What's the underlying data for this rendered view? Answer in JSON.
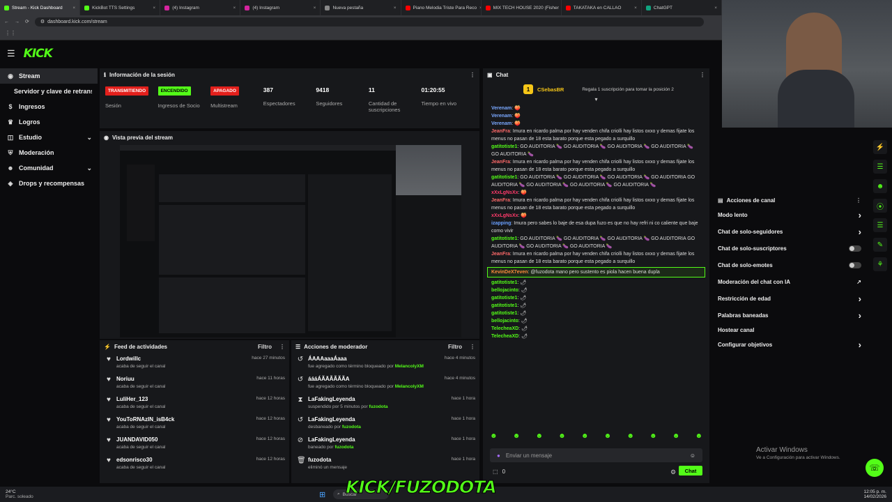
{
  "browser": {
    "tabs": [
      {
        "label": "Stream - Kick Dashboard",
        "color": "#53fc18",
        "active": true
      },
      {
        "label": "KickBot TTS Settings",
        "color": "#53fc18"
      },
      {
        "label": "(4) Instagram",
        "color": "#d6249f"
      },
      {
        "label": "(4) Instagram",
        "color": "#d6249f"
      },
      {
        "label": "Nueva pestaña",
        "color": "#888888"
      },
      {
        "label": "Piano Melodia Triste Para Reco",
        "color": "#ff0000"
      },
      {
        "label": "MIX TECH HOUSE 2020 (Fisher",
        "color": "#ff0000"
      },
      {
        "label": "TAKATAKA en CALLAO",
        "color": "#ff0000"
      },
      {
        "label": "ChatGPT",
        "color": "#10a37f"
      }
    ],
    "url": "dashboard.kick.com/stream"
  },
  "app": {
    "logo": "KICK"
  },
  "sidebar": {
    "items": [
      {
        "label": "Stream",
        "icon": "broadcast-icon",
        "active": true
      },
      {
        "label": "Servidor y clave de retransmisión",
        "icon": ""
      },
      {
        "label": "Ingresos",
        "icon": "money-icon"
      },
      {
        "label": "Logros",
        "icon": "trophy-icon"
      },
      {
        "label": "Estudio",
        "icon": "layers-icon",
        "chevron": true
      },
      {
        "label": "Moderación",
        "icon": "shield-icon"
      },
      {
        "label": "Comunidad",
        "icon": "people-icon",
        "chevron": true
      },
      {
        "label": "Drops y recompensas",
        "icon": "gift-icon"
      }
    ]
  },
  "session": {
    "title": "Información de la sesión",
    "stats": [
      {
        "badge": "TRANSMITIENDO",
        "badge_bg": "#e3201c",
        "badge_fg": "#ffffff",
        "label": "Sesión"
      },
      {
        "badge": "ENCENDIDO",
        "badge_bg": "#53fc18",
        "badge_fg": "#000000",
        "label": "Ingresos de Socio"
      },
      {
        "badge": "APAGADO",
        "badge_bg": "#e3201c",
        "badge_fg": "#ffffff",
        "label": "Multistream"
      },
      {
        "value": "387",
        "label": "Espectadores"
      },
      {
        "value": "9418",
        "label": "Seguidores"
      },
      {
        "value": "11",
        "label": "Cantidad de suscripciones"
      },
      {
        "value": "01:20:55",
        "label": "Tiempo en vivo"
      }
    ]
  },
  "preview": {
    "title": "Vista previa del stream"
  },
  "activity": {
    "title": "Feed de actividades",
    "filter": "Filtro",
    "rows": [
      {
        "name": "Lordwillc",
        "detail": "acaba de seguir el canal",
        "time": "hace 27 minutos"
      },
      {
        "name": "Noriuu",
        "detail": "acaba de seguir el canal",
        "time": "hace 11 horas"
      },
      {
        "name": "LuliHer_123",
        "detail": "acaba de seguir el canal",
        "time": "hace 12 horas"
      },
      {
        "name": "YouToRNAzIN_isB4ck",
        "detail": "acaba de seguir el canal",
        "time": "hace 12 horas"
      },
      {
        "name": "JUANDAVID050",
        "detail": "acaba de seguir el canal",
        "time": "hace 12 horas"
      },
      {
        "name": "edsonrisco30",
        "detail": "acaba de seguir el canal",
        "time": "hace 12 horas"
      }
    ]
  },
  "modactions": {
    "title": "Acciones de moderador",
    "filter": "Filtro",
    "rows": [
      {
        "icon": "↺",
        "name": "ÁAAAaaaÁaaa",
        "detail": "fue agregado como término bloqueado por",
        "who": "MelancolyXM",
        "time": "hace 4 minutos"
      },
      {
        "icon": "↺",
        "name": "áááÁÃÄÃÃÃÃA",
        "detail": "fue agregado como término bloqueado por",
        "who": "MelancolyXM",
        "time": "hace 4 minutos"
      },
      {
        "icon": "⧗",
        "name": "LaFakingLeyenda",
        "detail": "suspendido por 5 minutos por",
        "who": "fuzodota",
        "time": "hace 1 hora"
      },
      {
        "icon": "↺",
        "name": "LaFakingLeyenda",
        "detail": "desbaneado por",
        "who": "fuzodota",
        "time": "hace 1 hora"
      },
      {
        "icon": "⊘",
        "name": "LaFakingLeyenda",
        "detail": "baneado por",
        "who": "fuzodota",
        "time": "hace 1 hora"
      },
      {
        "icon": "🗑",
        "name": "fuzodota",
        "detail": "eliminó un mensaje",
        "who": "",
        "time": "hace 1 hora"
      }
    ]
  },
  "chat": {
    "title": "Chat",
    "pinned_user": "CSebasBR",
    "pinned_text": "Regala 1 suscripción para tomar la posición 2",
    "messages": [
      {
        "user": "Verenam",
        "color": "#7aa8ff",
        "text": "🍑"
      },
      {
        "user": "Verenam",
        "color": "#7aa8ff",
        "text": "🍑"
      },
      {
        "user": "Verenam",
        "color": "#7aa8ff",
        "text": "🍑"
      },
      {
        "user": "JeanFra",
        "color": "#ff6a6a",
        "text": "Imura en ricardo palma por hay venden chifa criolli hay listos oxxo y demas fijate los menus no pasan de 18 esta barato porque esta pegado a surquillo"
      },
      {
        "user": "gatitotiste1",
        "color": "#53fc18",
        "text": "GO AUDITORIA 🍆 GO AUDITORIA 🍆 GO AUDITORIA 🍆 GO AUDITORIA 🍆 GO AUDITORIA 🍆"
      },
      {
        "user": "JeanFra",
        "color": "#ff6a6a",
        "text": "Imura en ricardo palma por hay venden chifa criolli hay listos oxxo y demas fijate los menus no pasan de 18 esta barato porque esta pegado a surquillo"
      },
      {
        "user": "gatitotiste1",
        "color": "#53fc18",
        "text": "GO AUDITORIA 🍆 GO AUDITORIA 🍆 GO AUDITORIA 🍆 GO AUDITORIA GO AUDITORIA 🍆 GO AUDITORIA 🍆 GO AUDITORIA 🍆 GO AUDITORIA 🍆"
      },
      {
        "user": "xXxLgNsXx",
        "color": "#ff3b6b",
        "text": "🍑"
      },
      {
        "user": "JeanFra",
        "color": "#ff6a6a",
        "text": "Imura en ricardo palma por hay venden chifa criolli hay listos oxxo y demas fijate los menus no pasan de 18 esta barato porque esta pegado a surquillo"
      },
      {
        "user": "xXxLgNsXx",
        "color": "#ff3b6b",
        "text": "🍑"
      },
      {
        "user": "izapping",
        "color": "#6aa0ff",
        "text": "Imura pero sabes lo baje de esa dupa fuzo es que no hay refri ni co caliente que baje como vivir"
      },
      {
        "user": "gatitotiste1",
        "color": "#53fc18",
        "text": "GO AUDITORIA 🍆 GO AUDITORIA 🍆 GO AUDITORIA 🍆 GO AUDITORIA GO AUDITORIA 🍆 GO AUDITORIA 🍆 GO AUDITORIA 🍆"
      },
      {
        "user": "JeanFra",
        "color": "#ff6a6a",
        "text": "Imura en ricardo palma por hay venden chifa criolli hay listos oxxo y demas fijate los menus no pasan de 18 esta barato porque esta pegado a surquillo"
      },
      {
        "user": "KevinDeX7even",
        "color": "#ff8a3d",
        "text": "@fuzodota mano pero sustento es piola hacen buena dupla",
        "highlight": true
      },
      {
        "user": "gatitotiste1",
        "color": "#53fc18",
        "text": "🌶"
      },
      {
        "user": "bellojacinto",
        "color": "#53fc18",
        "text": "🌶"
      },
      {
        "user": "gatitotiste1",
        "color": "#53fc18",
        "text": "🌶"
      },
      {
        "user": "gatitotiste1",
        "color": "#53fc18",
        "text": "🌶"
      },
      {
        "user": "gatitotiste1",
        "color": "#53fc18",
        "text": "🌶"
      },
      {
        "user": "bellojacinto",
        "color": "#53fc18",
        "text": "🌶"
      },
      {
        "user": "TelecheaXD",
        "color": "#53fc18",
        "text": "🌶"
      },
      {
        "user": "TelecheaXD",
        "color": "#53fc18",
        "text": "🌶"
      }
    ],
    "input_placeholder": "Enviar un mensaje",
    "count": "0",
    "send_label": "Chat"
  },
  "channel": {
    "title": "Acciones de canal",
    "options": [
      {
        "label": "Modo lento",
        "right": "chevron"
      },
      {
        "label": "Chat de solo-seguidores",
        "right": "chevron"
      },
      {
        "label": "Chat de solo-suscriptores",
        "right": "toggle"
      },
      {
        "label": "Chat de solo-emotes",
        "right": "toggle"
      },
      {
        "label": "Moderación del chat con IA",
        "right": "external"
      },
      {
        "label": "Restricción de edad",
        "right": "chevron"
      },
      {
        "label": "Palabras baneadas",
        "right": "chevron"
      },
      {
        "label": "Hostear canal",
        "right": ""
      },
      {
        "label": "Configurar objetivos",
        "right": "chevron"
      }
    ]
  },
  "overlay": {
    "text": "KICK/FUZODOTA"
  },
  "windows": {
    "activate_title": "Activar Windows",
    "activate_sub": "Ve a Configuración para activar Windows.",
    "weather_temp": "24°C",
    "weather_text": "Parc. soleado",
    "search": "Buscar",
    "time": "12:05 p. m.",
    "date": "14/02/2026"
  },
  "colors": {
    "accent": "#53fc18",
    "panel": "#17181b",
    "bg": "#0b0b0d"
  }
}
